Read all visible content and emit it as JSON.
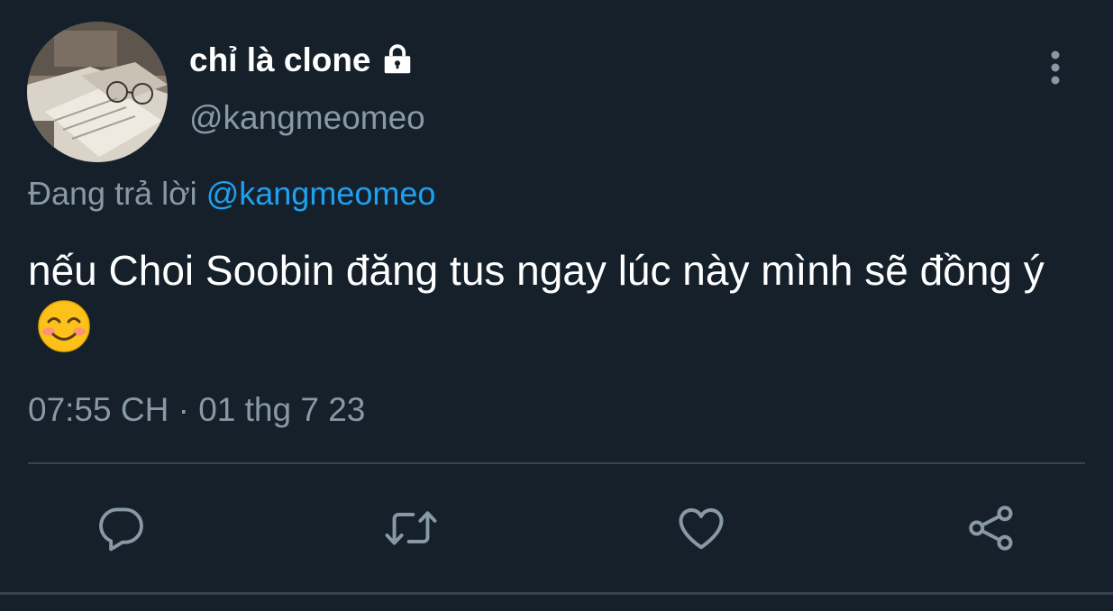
{
  "tweet": {
    "author": {
      "display_name": "chỉ là clone",
      "handle": "@kangmeomeo",
      "protected_icon": "lock-icon",
      "avatar": "avatar-photo-books-glasses"
    },
    "reply_context": {
      "prefix": "Đang trả lời",
      "handle": "@kangmeomeo"
    },
    "text": "nếu Choi Soobin đăng tus ngay lúc này mình sẽ đồng ý",
    "emoji": "smiling-face-with-smiling-eyes",
    "timestamp": "07:55 CH · 01 thg 7 23"
  },
  "actions": [
    {
      "name": "reply",
      "icon": "reply-icon"
    },
    {
      "name": "retweet",
      "icon": "retweet-icon"
    },
    {
      "name": "like",
      "icon": "heart-icon"
    },
    {
      "name": "share",
      "icon": "share-icon"
    }
  ],
  "colors": {
    "background": "#15202b",
    "primary_text": "#ffffff",
    "secondary_text": "#8899a6",
    "link": "#1da1f2",
    "divider": "#38444d"
  }
}
